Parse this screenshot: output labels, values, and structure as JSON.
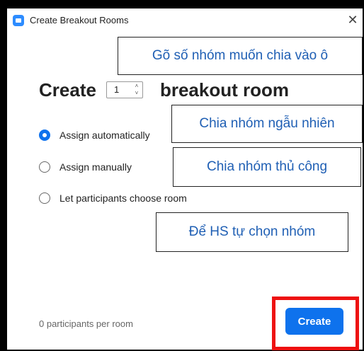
{
  "window": {
    "title": "Create Breakout Rooms",
    "close_glyph": "✕"
  },
  "create_row": {
    "create_label": "Create",
    "room_count": "1",
    "stepper_up_glyph": "˄",
    "stepper_down_glyph": "˅",
    "breakout_label": "breakout room"
  },
  "options": [
    {
      "label": "Assign automatically",
      "selected": true
    },
    {
      "label": "Assign manually",
      "selected": false
    },
    {
      "label": "Let participants choose room",
      "selected": false
    }
  ],
  "annotations": {
    "count_hint": "Gõ số nhóm muốn chia vào ô",
    "auto_hint": "Chia nhóm ngẫu nhiên",
    "manual_hint": "Chia nhóm thủ công",
    "choose_hint": "Để HS tự chọn nhóm"
  },
  "footer": {
    "participants_text": "0 participants per room",
    "create_button": "Create"
  },
  "colors": {
    "accent": "#0e72ed",
    "highlight_frame": "#e11111",
    "annotation_text": "#1f5fb4"
  }
}
